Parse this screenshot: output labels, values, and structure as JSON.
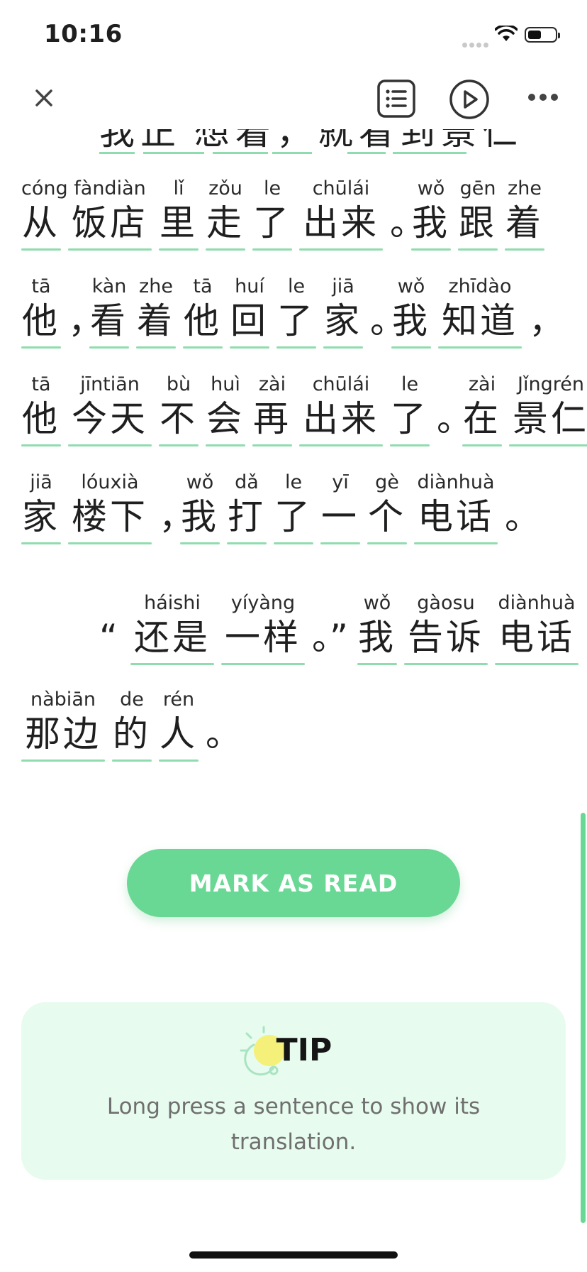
{
  "status_bar": {
    "time": "10:16"
  },
  "toolbar": {
    "close_icon": "close-icon",
    "list_icon": "list-icon",
    "play_icon": "play-icon",
    "more_icon": "more-icon"
  },
  "reader": {
    "partial_line": [
      "我",
      "正",
      "想",
      "着",
      "，",
      "就",
      "看",
      "到",
      "景",
      "仁"
    ],
    "lines": [
      [
        {
          "py": "cóng",
          "hz": "从"
        },
        {
          "py": "fàndiàn",
          "hz": "饭店"
        },
        {
          "py": "lǐ",
          "hz": "里"
        },
        {
          "py": "zǒu",
          "hz": "走"
        },
        {
          "py": "le",
          "hz": "了"
        },
        {
          "py": "chūlái",
          "hz": "出来"
        },
        {
          "punct": "。"
        },
        {
          "py": "wǒ",
          "hz": "我"
        },
        {
          "py": "gēn",
          "hz": "跟"
        },
        {
          "py": "zhe",
          "hz": "着"
        }
      ],
      [
        {
          "py": "tā",
          "hz": "他"
        },
        {
          "punct": "，"
        },
        {
          "py": "kàn",
          "hz": "看"
        },
        {
          "py": "zhe",
          "hz": "着"
        },
        {
          "py": "tā",
          "hz": "他"
        },
        {
          "py": "huí",
          "hz": "回"
        },
        {
          "py": "le",
          "hz": "了"
        },
        {
          "py": "jiā",
          "hz": "家"
        },
        {
          "punct": "。"
        },
        {
          "py": "wǒ",
          "hz": "我"
        },
        {
          "py": "zhīdào",
          "hz": "知道"
        },
        {
          "punct": "，"
        }
      ],
      [
        {
          "py": "tā",
          "hz": "他"
        },
        {
          "py": "jīntiān",
          "hz": "今天"
        },
        {
          "py": "bù",
          "hz": "不"
        },
        {
          "py": "huì",
          "hz": "会"
        },
        {
          "py": "zài",
          "hz": "再"
        },
        {
          "py": "chūlái",
          "hz": "出来"
        },
        {
          "py": "le",
          "hz": "了"
        },
        {
          "punct": "。"
        },
        {
          "py": "zài",
          "hz": "在"
        },
        {
          "py": "Jǐngrén",
          "hz": "景仁"
        }
      ],
      [
        {
          "py": "jiā",
          "hz": "家"
        },
        {
          "py": "lóuxià",
          "hz": "楼下"
        },
        {
          "punct": "，"
        },
        {
          "py": "wǒ",
          "hz": "我"
        },
        {
          "py": "dǎ",
          "hz": "打"
        },
        {
          "py": "le",
          "hz": "了"
        },
        {
          "py": "yī",
          "hz": "一"
        },
        {
          "py": "gè",
          "hz": "个"
        },
        {
          "py": "diànhuà",
          "hz": "电话"
        },
        {
          "punct": "。"
        }
      ],
      [
        {
          "punct": "“"
        },
        {
          "py": "háishi",
          "hz": "还是"
        },
        {
          "py": "yíyàng",
          "hz": "一样"
        },
        {
          "punct": "。”"
        },
        {
          "py": "wǒ",
          "hz": "我"
        },
        {
          "py": "gàosu",
          "hz": "告诉"
        },
        {
          "py": "diànhuà",
          "hz": "电话"
        }
      ],
      [
        {
          "py": "nàbiān",
          "hz": "那边"
        },
        {
          "py": "de",
          "hz": "的"
        },
        {
          "py": "rén",
          "hz": "人"
        },
        {
          "punct": "。"
        }
      ]
    ]
  },
  "actions": {
    "mark_as_read_label": "MARK AS READ"
  },
  "tip": {
    "title": "TIP",
    "text": "Long press a sentence to show its translation."
  },
  "colors": {
    "accent": "#69d894",
    "underline": "#8fdcae",
    "tip_background": "#e7fbef",
    "tip_bulb": "#f4f07a"
  }
}
